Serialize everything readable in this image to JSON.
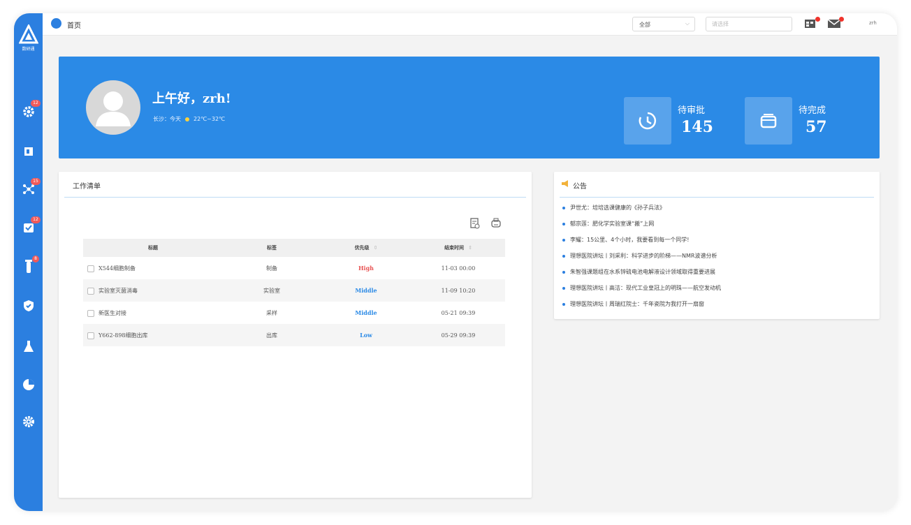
{
  "sidebar": {
    "logo_text": "数研通",
    "badges": [
      "12",
      "15",
      "12",
      "8"
    ]
  },
  "topbar": {
    "home_label": "首页",
    "select_value": "全部",
    "search_placeholder": "请选择",
    "user_label": "zrh"
  },
  "banner": {
    "greeting": "上午好，zrh!",
    "weather_label": "长沙：今天",
    "weather_temp": "22℃~32℃",
    "stats": [
      {
        "label": "待审批",
        "value": "145"
      },
      {
        "label": "待完成",
        "value": "57"
      }
    ]
  },
  "worklist": {
    "title": "工作清单",
    "columns": [
      "标题",
      "标签",
      "优先级",
      "结束时间"
    ],
    "rows": [
      {
        "title": "X544细胞制备",
        "tag": "制备",
        "priority": "High",
        "end": "11-03 00:00"
      },
      {
        "title": "实验室灭菌消毒",
        "tag": "实验室",
        "priority": "Middle",
        "end": "11-09 10:20"
      },
      {
        "title": "新医生对接",
        "tag": "采样",
        "priority": "Middle",
        "end": "05-21 09:39"
      },
      {
        "title": "Y662-898细胞出库",
        "tag": "出库",
        "priority": "Low",
        "end": "05-29 09:39"
      }
    ]
  },
  "notice": {
    "title": "公告",
    "items": [
      "尹世尤：培培选课健康的《孙子兵法》",
      "郁宗莲：肥化学实验室课“搬”上网",
      "李耀：15公里、4个小时，我要看到每一个同学!",
      "理想医院讲坛丨刘采利：科学进步的阶梯——NMR波谱分析",
      "朱智强课题组在水系锌硫电池电解液设计领域取得重要进展",
      "理想医院讲坛丨高洁：现代工业皇冠上的明珠——航空发动机",
      "理想医院讲坛丨周瑞红院士：千年瓷院为我打开一扇窗"
    ]
  },
  "colors": {
    "primary": "#2b8ae6",
    "sidebar": "#2b7fe0",
    "high": "#e85353"
  }
}
